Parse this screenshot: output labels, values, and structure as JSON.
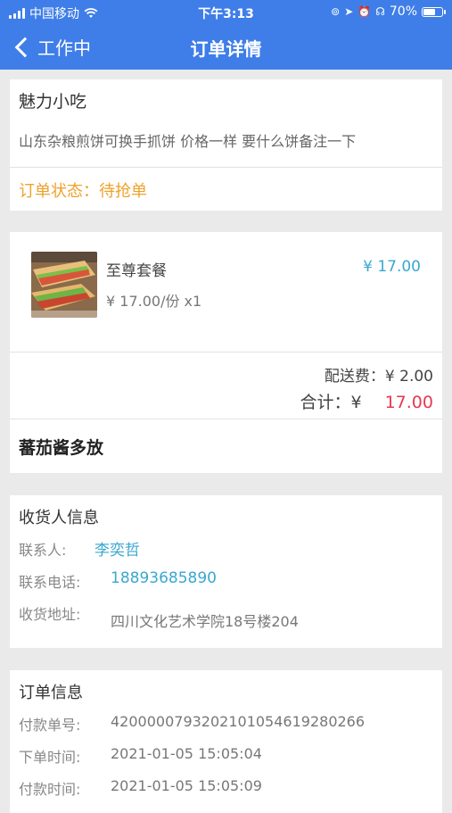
{
  "status_bar": {
    "carrier": "中国移动",
    "time": "下午3:13",
    "battery": "70%",
    "battery_level": 0.7
  },
  "nav": {
    "back_label": "工作中",
    "title": "订单详情"
  },
  "shop": {
    "name": "魅力小吃",
    "description": "山东杂粮煎饼可换手抓饼 价格一样 要什么饼备注一下",
    "status_label": "订单状态：待抢单"
  },
  "order_items": {
    "items": [
      {
        "name": "至尊套餐",
        "price": "¥ 17.00",
        "unit": "¥ 17.00/份 x1",
        "image": "wrap-sandwich-photo"
      }
    ],
    "delivery_fee": "配送费：¥ 2.00",
    "total_label": "合计：¥",
    "total_amount": "17.00",
    "note": "蕃茄酱多放"
  },
  "consignee": {
    "title": "收货人信息",
    "contact_label": "联系人:",
    "contact_name": "李奕哲",
    "phone_label": "联系电话:",
    "phone": "18893685890",
    "address_label": "收货地址:",
    "address": "四川文化艺术学院18号楼204"
  },
  "order_info": {
    "title": "订单信息",
    "payment_no_label": "付款单号:",
    "payment_no": "4200000793202101054619280266",
    "order_time_label": "下单时间:",
    "order_time": "2021-01-05 15:05:04",
    "pay_time_label": "付款时间:",
    "pay_time": "2021-01-05 15:05:09"
  },
  "colors": {
    "nav_blue": "#3f7ee8",
    "status_orange": "#f0a12c",
    "link_blue": "#3aa7cf",
    "total_red": "#e8384f"
  }
}
